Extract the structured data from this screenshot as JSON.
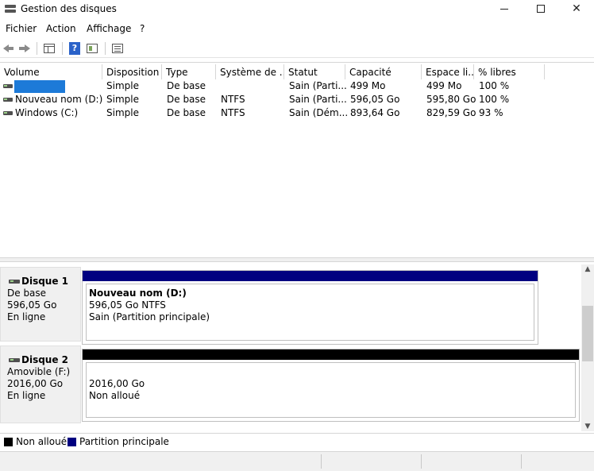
{
  "window": {
    "title": "Gestion des disques",
    "controls": {
      "minimize": "minimize",
      "maximize": "maximize",
      "close": "✕"
    }
  },
  "menu": [
    "Fichier",
    "Action",
    "Affichage",
    "?"
  ],
  "toolbar": {
    "icons": [
      "back-arrow-icon",
      "forward-arrow-icon",
      "properties-icon",
      "help-icon",
      "show-hide-console-tree-icon",
      "list-view-icon"
    ]
  },
  "volume_table": {
    "columns": [
      "Volume",
      "Disposition",
      "Type",
      "Système de ...",
      "Statut",
      "Capacité",
      "Espace li...",
      "% libres"
    ],
    "rows": [
      {
        "volume": "",
        "disposition": "Simple",
        "type": "De base",
        "fs": "",
        "status": "Sain (Parti...",
        "capacity": "499 Mo",
        "free": "499 Mo",
        "pct": "100 %"
      },
      {
        "volume": "Nouveau nom (D:)",
        "disposition": "Simple",
        "type": "De base",
        "fs": "NTFS",
        "status": "Sain (Parti...",
        "capacity": "596,05 Go",
        "free": "595,80 Go",
        "pct": "100 %"
      },
      {
        "volume": "Windows (C:)",
        "disposition": "Simple",
        "type": "De base",
        "fs": "NTFS",
        "status": "Sain (Dém...",
        "capacity": "893,64 Go",
        "free": "829,59 Go",
        "pct": "93 %"
      }
    ]
  },
  "disks": [
    {
      "name": "Disque 1",
      "kind": "De base",
      "size": "596,05 Go",
      "state": "En ligne",
      "partition": {
        "name": "Nouveau nom  (D:)",
        "size_fs": "596,05 Go NTFS",
        "status": "Sain (Partition principale)",
        "bar_color": "#000080"
      }
    },
    {
      "name": "Disque 2",
      "kind": "Amovible (F:)",
      "size": "2016,00 Go",
      "state": "En ligne",
      "partition": {
        "name": "",
        "size_fs": "2016,00 Go",
        "status": "Non alloué",
        "bar_color": "#000000"
      }
    }
  ],
  "legend": [
    {
      "label": "Non alloué",
      "color": "#000000"
    },
    {
      "label": "Partition principale",
      "color": "#000080"
    }
  ],
  "colors": {
    "selection_highlight": "#1d7ad8",
    "unallocated": "#000000",
    "primary_partition": "#000080"
  }
}
